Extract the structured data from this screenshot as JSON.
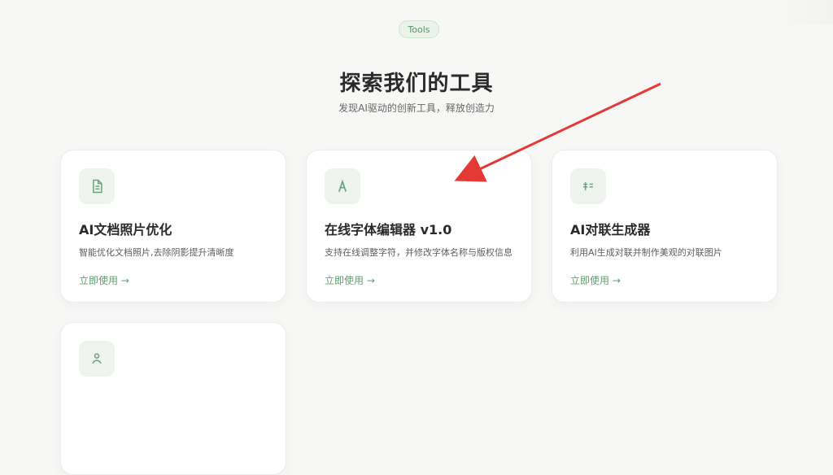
{
  "header": {
    "badge": "Tools",
    "title": "探索我们的工具",
    "subtitle": "发现AI驱动的创新工具，释放创造力"
  },
  "cards": [
    {
      "icon": "document-icon",
      "title": "AI文档照片优化",
      "description": "智能优化文档照片,去除阴影提升清晰度",
      "link": "立即使用 →"
    },
    {
      "icon": "font-icon",
      "title": "在线字体编辑器 v1.0",
      "description": "支持在线调整字符，并修改字体名称与版权信息",
      "link": "立即使用 →"
    },
    {
      "icon": "couplet-icon",
      "title": "AI对联生成器",
      "description": "利用AI生成对联并制作美观的对联图片",
      "link": "立即使用 →"
    },
    {
      "icon": "user-icon"
    }
  ],
  "colors": {
    "accent": "#5f9f6e",
    "annotation_arrow": "#e53935"
  }
}
